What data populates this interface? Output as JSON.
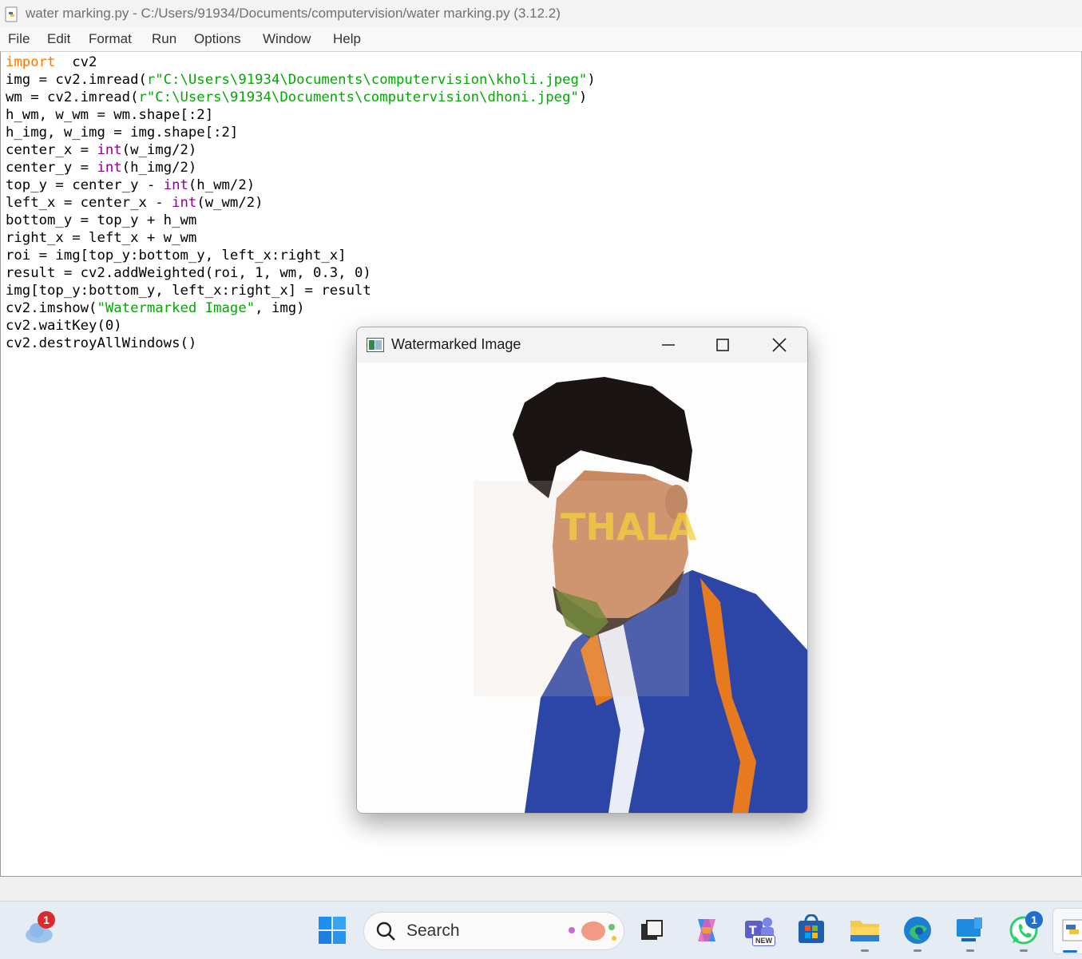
{
  "editor_window": {
    "title": "water marking.py - C:/Users/91934/Documents/computervision/water marking.py (3.12.2)",
    "menu": [
      "File",
      "Edit",
      "Format",
      "Run",
      "Options",
      "Window",
      "Help"
    ]
  },
  "code_lines": [
    [
      [
        "kw",
        "import"
      ],
      [
        "",
        "  cv2"
      ]
    ],
    [
      [
        "",
        "img = cv2.imread("
      ],
      [
        "st",
        "r\"C:\\Users\\91934\\Documents\\computervision\\kholi.jpeg\""
      ],
      [
        "",
        ")"
      ]
    ],
    [
      [
        "",
        "wm = cv2.imread("
      ],
      [
        "st",
        "r\"C:\\Users\\91934\\Documents\\computervision\\dhoni.jpeg\""
      ],
      [
        "",
        ")"
      ]
    ],
    [
      [
        "",
        "h_wm, w_wm = wm.shape[:2]"
      ]
    ],
    [
      [
        "",
        "h_img, w_img = img.shape[:2]"
      ]
    ],
    [
      [
        "",
        "center_x = "
      ],
      [
        "bi",
        "int"
      ],
      [
        "",
        "(w_img/2)"
      ]
    ],
    [
      [
        "",
        "center_y = "
      ],
      [
        "bi",
        "int"
      ],
      [
        "",
        "(h_img/2)"
      ]
    ],
    [
      [
        "",
        "top_y = center_y - "
      ],
      [
        "bi",
        "int"
      ],
      [
        "",
        "(h_wm/2)"
      ]
    ],
    [
      [
        "",
        "left_x = center_x - "
      ],
      [
        "bi",
        "int"
      ],
      [
        "",
        "(w_wm/2)"
      ]
    ],
    [
      [
        "",
        "bottom_y = top_y + h_wm"
      ]
    ],
    [
      [
        "",
        "right_x = left_x + w_wm"
      ]
    ],
    [
      [
        "",
        "roi = img[top_y:bottom_y, left_x:right_x]"
      ]
    ],
    [
      [
        "",
        "result = cv2.addWeighted(roi, 1, wm, 0.3, 0)"
      ]
    ],
    [
      [
        "",
        "img[top_y:bottom_y, left_x:right_x] = result"
      ]
    ],
    [
      [
        "",
        "cv2.imshow("
      ],
      [
        "st",
        "\"Watermarked Image\""
      ],
      [
        "",
        ", img)"
      ]
    ],
    [
      [
        "",
        "cv2.waitKey(0)"
      ]
    ],
    [
      [
        "",
        "cv2.destroyAllWindows()"
      ]
    ]
  ],
  "popup": {
    "title": "Watermarked Image",
    "watermark_text": "THALA"
  },
  "taskbar": {
    "search_label": "Search",
    "weather_badge": "1",
    "whatsapp_badge": "1",
    "teams_badge": "NEW"
  },
  "colors": {
    "keyword": "#ff7700",
    "builtin": "#900090",
    "string": "#00aa00",
    "taskbar_bg": "#e6ecf3",
    "badge": "#d92b2b"
  }
}
